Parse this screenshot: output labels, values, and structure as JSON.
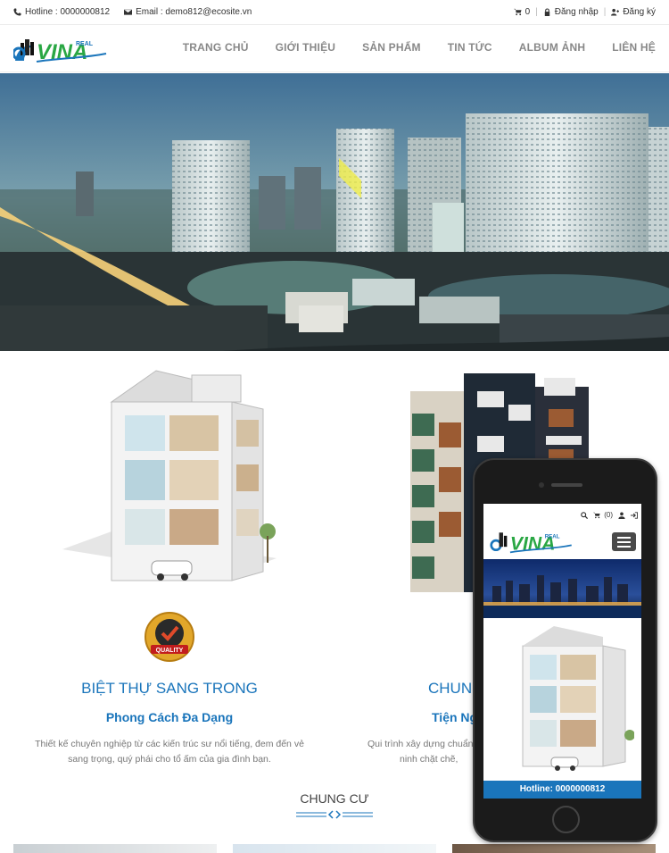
{
  "topbar": {
    "hotline": "Hotline : 0000000812",
    "email": "Email : demo812@ecosite.vn",
    "cart_count": "0",
    "login": "Đăng nhập",
    "register": "Đăng ký"
  },
  "logo": {
    "text": "VINA",
    "tag": "REAL"
  },
  "nav": [
    "TRANG CHỦ",
    "GIỚI THIỆU",
    "SẢN PHẨM",
    "TIN TỨC",
    "ALBUM ẢNH",
    "LIÊN HỆ"
  ],
  "features": [
    {
      "title": "BIỆT THỰ SANG TRONG",
      "subtitle": "Phong Cách Đa Dạng",
      "desc": "Thiết kế chuyên nghiệp từ các kiến trúc sư nổi tiếng, đem đến vẻ sang trọng, quý phái cho tổ ấm của gia đình bạn."
    },
    {
      "title": "CHUNG",
      "subtitle": "Tiện Ng",
      "desc_line1": "Qui trình xây dựng chuẩn,",
      "desc_line2": "ninh chặt chẽ,"
    }
  ],
  "badge": "QUALITY",
  "section": {
    "title": "CHUNG CƯ"
  },
  "phone": {
    "cart": "(0)",
    "hotline": "Hotline: 0000000812"
  },
  "colors": {
    "accent": "#1a75bb",
    "nav": "#888888"
  }
}
